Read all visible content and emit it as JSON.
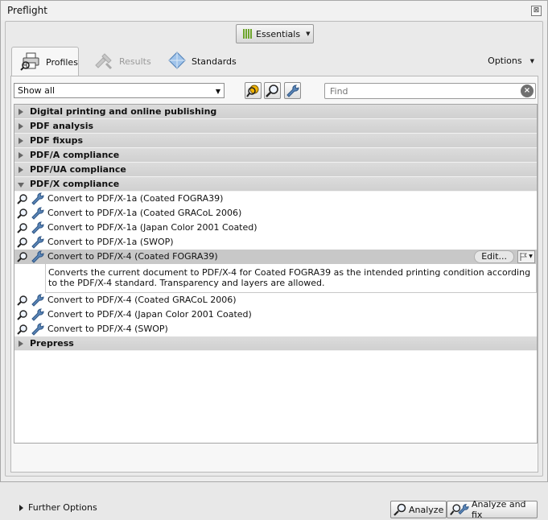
{
  "window": {
    "title": "Preflight",
    "close_glyph": "⊠"
  },
  "toolbar": {
    "essentials_label": "Essentials"
  },
  "tabs": [
    {
      "label": "Profiles",
      "icon": "printer-icon",
      "active": true
    },
    {
      "label": "Results",
      "icon": "results-icon",
      "active": false
    },
    {
      "label": "Standards",
      "icon": "diamond-icon",
      "active": false
    }
  ],
  "options_label": "Options",
  "filter": {
    "selected": "Show all"
  },
  "find": {
    "placeholder": "Find"
  },
  "categories_top": [
    "Digital printing and online publishing",
    "PDF analysis",
    "PDF fixups",
    "PDF/A compliance",
    "PDF/UA compliance"
  ],
  "open_category": "PDF/X compliance",
  "profiles_before": [
    "Convert to PDF/X-1a (Coated FOGRA39)",
    "Convert to PDF/X-1a (Coated GRACoL 2006)",
    "Convert to PDF/X-1a (Japan Color 2001 Coated)",
    "Convert to PDF/X-1a (SWOP)"
  ],
  "selected_profile": {
    "label": "Convert to PDF/X-4 (Coated FOGRA39)",
    "edit_label": "Edit...",
    "description": "Converts the current document to PDF/X-4 for Coated FOGRA39 as the intended printing condition according to the PDF/X-4 standard. Transparency and layers are allowed."
  },
  "profiles_after": [
    "Convert to PDF/X-4 (Coated GRACoL 2006)",
    "Convert to PDF/X-4 (Japan Color 2001 Coated)",
    "Convert to PDF/X-4 (SWOP)"
  ],
  "categories_bottom": [
    "Prepress"
  ],
  "further_options": "Further Options",
  "buttons": {
    "analyze": "Analyze",
    "analyze_fix": "Analyze and fix"
  },
  "colors": {
    "accent_green": "#6ea52c",
    "selected_row": "#c8c8c8",
    "category_bar": "#d6d6d6"
  }
}
